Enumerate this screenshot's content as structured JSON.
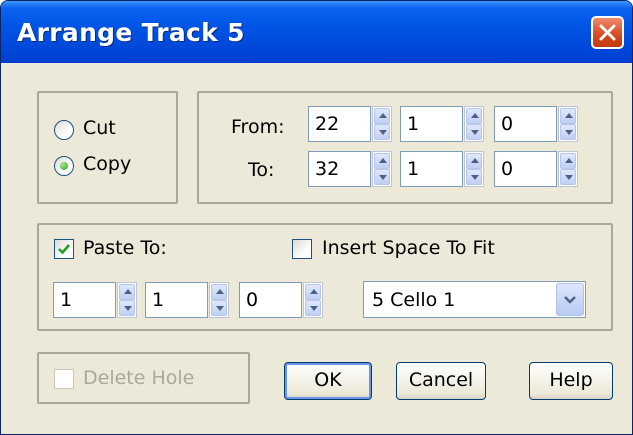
{
  "window": {
    "title": "Arrange Track 5",
    "close_icon": "close-x-icon"
  },
  "mode": {
    "options": [
      {
        "label": "Cut",
        "checked": false
      },
      {
        "label": "Copy",
        "checked": true
      }
    ]
  },
  "range": {
    "from_label": "From:",
    "to_label": "To:",
    "from": {
      "measure": "22",
      "beat": "1",
      "tick": "0"
    },
    "to": {
      "measure": "32",
      "beat": "1",
      "tick": "0"
    }
  },
  "paste": {
    "paste_to_label": "Paste To:",
    "paste_to_checked": true,
    "insert_space_label": "Insert Space To Fit",
    "insert_space_checked": false,
    "position": {
      "measure": "1",
      "beat": "1",
      "tick": "0"
    },
    "track_selected": "5 Cello 1"
  },
  "footer": {
    "delete_hole_label": "Delete Hole",
    "delete_hole_checked": false,
    "delete_hole_enabled": false,
    "ok_label": "OK",
    "cancel_label": "Cancel",
    "help_label": "Help"
  },
  "colors": {
    "titlebar": "#0055e5",
    "dialog_bg": "#ece9d8",
    "close_button": "#d6481f",
    "group_border": "#aca899"
  }
}
